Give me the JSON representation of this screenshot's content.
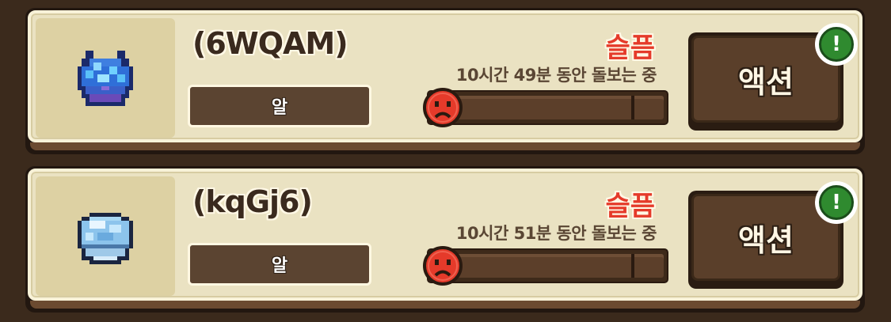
{
  "colors": {
    "background": "#3b2a1c",
    "card": "#eae2c2",
    "mood_bar_fill": "#d33a2a",
    "mood_label": "#e53a2a",
    "alert_badge": "#2f8a2f",
    "action_button": "#5a3f2a"
  },
  "pets": [
    {
      "name": "(6WQAM)",
      "type_label": "알",
      "mood_label": "슬픔",
      "mood_fraction": 0.0,
      "care_time": "10시간 49분 동안 돌보는 중",
      "action_label": "액션",
      "alert_symbol": "!",
      "icon": "blue-crystal-creature-icon"
    },
    {
      "name": "(kqGj6)",
      "type_label": "알",
      "mood_label": "슬픔",
      "mood_fraction": 0.0,
      "care_time": "10시간 51분 동안 돌보는 중",
      "action_label": "액션",
      "alert_symbol": "!",
      "icon": "blue-shell-egg-icon"
    }
  ]
}
